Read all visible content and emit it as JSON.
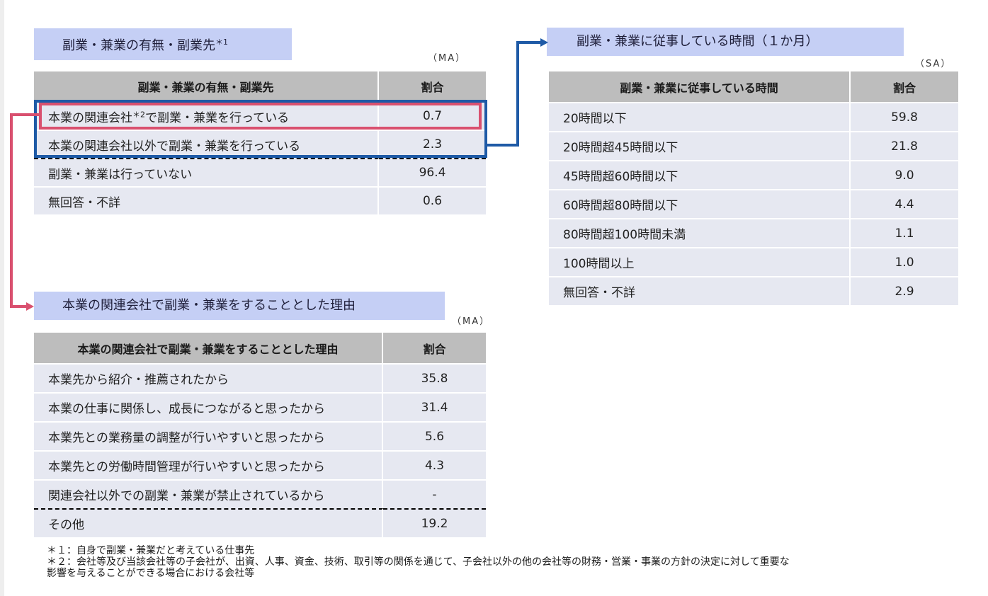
{
  "table1": {
    "title": "副業・兼業の有無・副業先",
    "title_sup": "＊1",
    "unit": "（MA）",
    "headers": [
      "副業・兼業の有無・副業先",
      "割合"
    ],
    "rows": [
      {
        "pre": "本業の関連会社",
        "sup": "＊2",
        "post": "で副業・兼業を行っている",
        "value": "0.7"
      },
      {
        "label": "本業の関連会社以外で副業・兼業を行っている",
        "value": "2.3"
      },
      {
        "label": "副業・兼業は行っていない",
        "value": "96.4"
      },
      {
        "label": "無回答・不詳",
        "value": "0.6"
      }
    ]
  },
  "table2": {
    "title": "副業・兼業に従事している時間（１か月）",
    "unit": "（SA）",
    "headers": [
      "副業・兼業に従事している時間",
      "割合"
    ],
    "rows": [
      {
        "label": "20時間以下",
        "value": "59.8"
      },
      {
        "label": "20時間超45時間以下",
        "value": "21.8"
      },
      {
        "label": "45時間超60時間以下",
        "value": "9.0"
      },
      {
        "label": "60時間超80時間以下",
        "value": "4.4"
      },
      {
        "label": "80時間超100時間未満",
        "value": "1.1"
      },
      {
        "label": "100時間以上",
        "value": "1.0"
      },
      {
        "label": "無回答・不詳",
        "value": "2.9"
      }
    ]
  },
  "table3": {
    "title": "本業の関連会社で副業・兼業をすることとした理由",
    "unit": "（MA）",
    "headers": [
      "本業の関連会社で副業・兼業をすることとした理由",
      "割合"
    ],
    "rows": [
      {
        "label": "本業先から紹介・推薦されたから",
        "value": "35.8"
      },
      {
        "label": "本業の仕事に関係し、成長につながると思ったから",
        "value": "31.4"
      },
      {
        "label": "本業先との業務量の調整が行いやすいと思ったから",
        "value": "5.6"
      },
      {
        "label": "本業先との労働時間管理が行いやすいと思ったから",
        "value": "4.3"
      },
      {
        "label": "関連会社以外での副業・兼業が禁止されているから",
        "value": "-"
      },
      {
        "label": "その他",
        "value": "19.2"
      }
    ]
  },
  "notes": [
    "＊１：自身で副業・兼業だと考えている仕事先",
    "＊２：会社等及び当該会社等の子会社が、出資、人事、資金、技術、取引等の関係を通じて、子会社以外の他の会社等の財務・営業・事業の方針の決定に対して重要な",
    "影響を与えることができる場合における会社等"
  ],
  "colors": {
    "title_bg": "#c5cff5",
    "header_bg": "#bdbdbd",
    "row_bg": "#e6e8f1",
    "blue_highlight": "#1e5aa6",
    "red_highlight": "#d9506f"
  }
}
